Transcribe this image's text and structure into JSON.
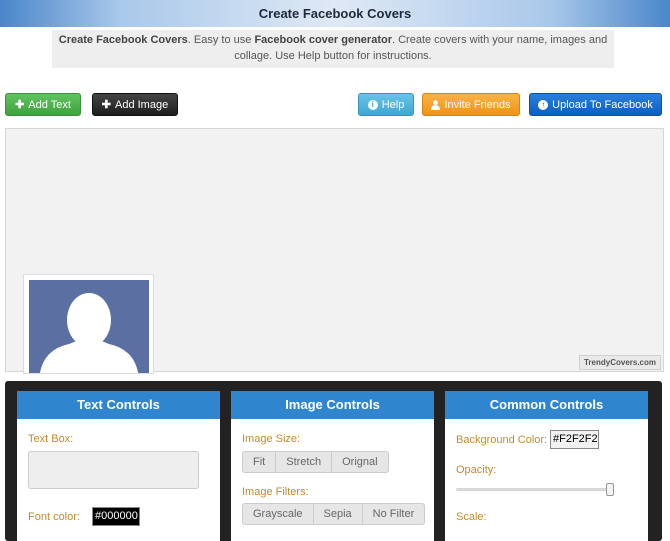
{
  "header": {
    "title": "Create Facebook Covers"
  },
  "intro": {
    "bold1": "Create Facebook Covers",
    "text1": ". Easy to use ",
    "bold2": "Facebook cover generator",
    "text2": ". Create covers with your name, images and collage. Use Help button for instructions."
  },
  "toolbar": {
    "add_text": "Add Text",
    "add_image": "Add Image",
    "help": "Help",
    "invite": "Invite Friends",
    "upload": "Upload To Facebook"
  },
  "canvas": {
    "watermark": "TrendyCovers.com"
  },
  "text_controls": {
    "title": "Text Controls",
    "text_box_label": "Text Box:",
    "text_box_value": "",
    "font_color_label": "Font color:",
    "font_color_value": "#000000"
  },
  "image_controls": {
    "title": "Image Controls",
    "size_label": "Image Size:",
    "size_options": [
      "Fit",
      "Stretch",
      "Orignal"
    ],
    "filters_label": "Image Filters:",
    "filter_options": [
      "Grayscale",
      "Sepia",
      "No Filter"
    ]
  },
  "common_controls": {
    "title": "Common Controls",
    "bg_color_label": "Background Color:",
    "bg_color_value": "#F2F2F2",
    "opacity_label": "Opacity:",
    "opacity_value": 1,
    "scale_label": "Scale:"
  },
  "colors": {
    "header_blue": "#2f86cf",
    "label_orange": "#c48a2a",
    "canvas_bg": "#f2f2f2",
    "dark_panel": "#222222"
  }
}
